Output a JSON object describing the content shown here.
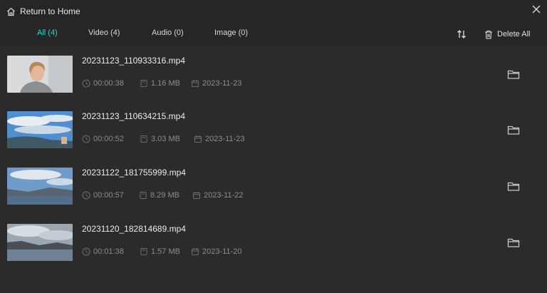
{
  "header": {
    "home_label": "Return to Home",
    "home_icon": "home-icon",
    "close_icon": "close-icon"
  },
  "tabs": [
    {
      "label": "All (4)",
      "active": true
    },
    {
      "label": "Video (4)",
      "active": false
    },
    {
      "label": "Audio (0)",
      "active": false
    },
    {
      "label": "Image (0)",
      "active": false
    }
  ],
  "toolbar": {
    "sort_icon": "sort-icon",
    "delete_all_label": "Delete All",
    "delete_icon": "trash-icon"
  },
  "colors": {
    "background": "#262626",
    "list_background": "#2b2b2b",
    "accent": "#2fd2d2",
    "meta_text": "#8c8c8c"
  },
  "files": [
    {
      "name": "20231123_110933316.mp4",
      "duration": "00:00:38",
      "size": "1.16 MB",
      "date": "2023-11-23",
      "thumbnail": "portrait-woman"
    },
    {
      "name": "20231123_110634215.mp4",
      "duration": "00:00:52",
      "size": "3.03 MB",
      "date": "2023-11-23",
      "thumbnail": "sky-landscape"
    },
    {
      "name": "20231122_181755999.mp4",
      "duration": "00:00:57",
      "size": "8.29 MB",
      "date": "2023-11-22",
      "thumbnail": "lake-landscape"
    },
    {
      "name": "20231120_182814689.mp4",
      "duration": "00:01:38",
      "size": "1.57 MB",
      "date": "2023-11-20",
      "thumbnail": "cloudy-lake"
    }
  ]
}
